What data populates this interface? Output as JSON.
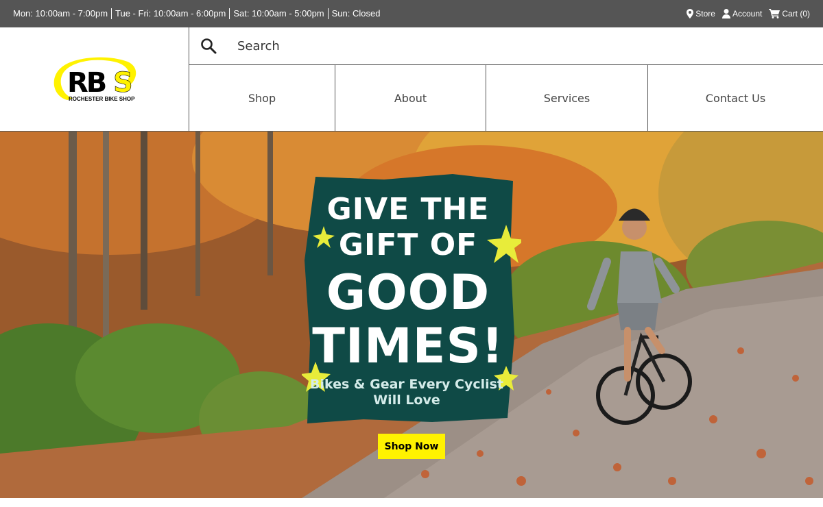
{
  "topbar": {
    "hours": [
      "Mon: 10:00am - 7:00pm",
      "Tue - Fri: 10:00am - 6:00pm",
      "Sat: 10:00am - 5:00pm",
      "Sun: Closed"
    ],
    "store_label": "Store",
    "account_label": "Account",
    "cart_label": "Cart (0)"
  },
  "logo": {
    "letters": "RBS",
    "tagline": "ROCHESTER BIKE SHOP"
  },
  "search": {
    "placeholder": "Search"
  },
  "nav": {
    "items": [
      {
        "label": "Shop"
      },
      {
        "label": "About"
      },
      {
        "label": "Services"
      },
      {
        "label": "Contact Us"
      }
    ]
  },
  "hero": {
    "headline_line1": "GIVE THE",
    "headline_line2": "GIFT OF",
    "headline_line3": "GOOD",
    "headline_line4": "TIMES!",
    "subline": "Bikes & Gear Every Cyclist Will Love",
    "cta_label": "Shop Now",
    "panel_color": "#0f4a46",
    "star_color": "#e8ec3a",
    "cta_color": "#fff200"
  },
  "colors": {
    "topbar": "#555555",
    "logo_yellow": "#fff200"
  }
}
